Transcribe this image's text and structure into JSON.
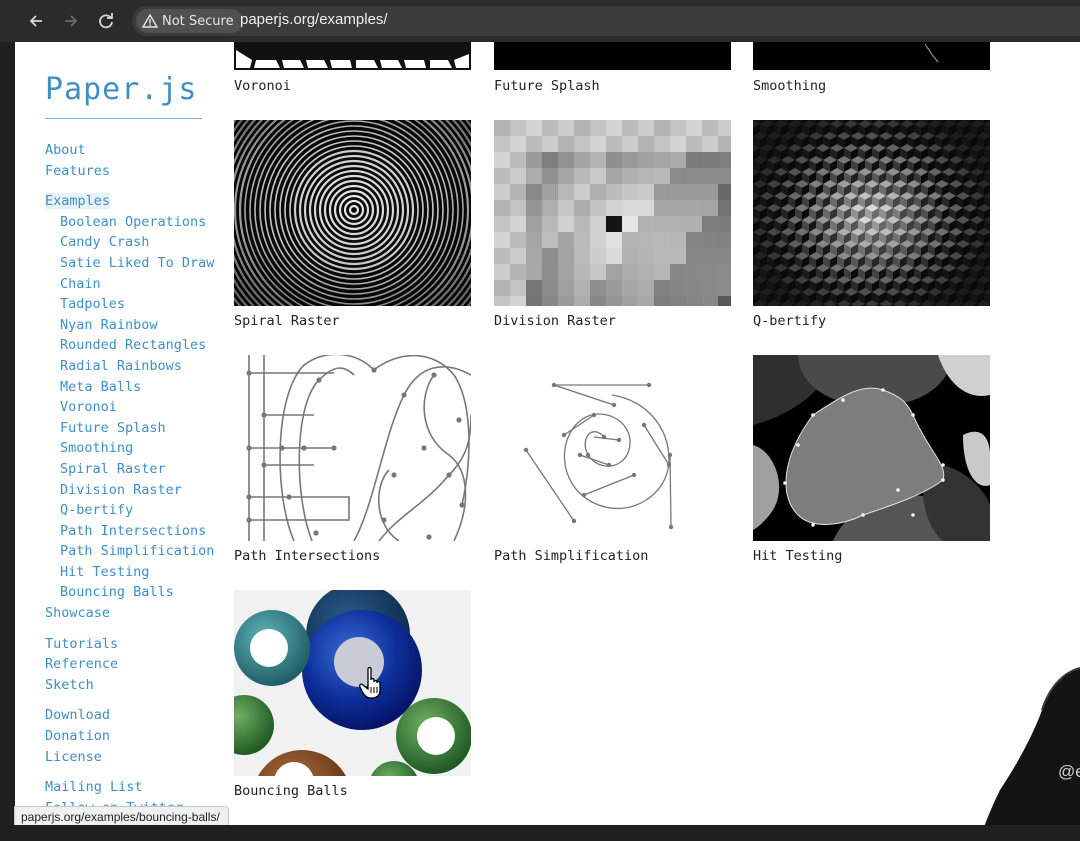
{
  "browser": {
    "back_icon": "arrow-left-icon",
    "forward_icon": "arrow-right-icon",
    "reload_icon": "reload-icon",
    "security_label": "Not Secure",
    "url": "paperjs.org/examples/"
  },
  "site": {
    "logo": "Paper.js"
  },
  "sidebar": {
    "group1": [
      "About",
      "Features"
    ],
    "examples_label": "Examples",
    "examples": [
      "Boolean Operations",
      "Candy Crash",
      "Satie Liked To Draw",
      "Chain",
      "Tadpoles",
      "Nyan Rainbow",
      "Rounded Rectangles",
      "Radial Rainbows",
      "Meta Balls",
      "Voronoi",
      "Future Splash",
      "Smoothing",
      "Spiral Raster",
      "Division Raster",
      "Q-bertify",
      "Path Intersections",
      "Path Simplification",
      "Hit Testing",
      "Bouncing Balls"
    ],
    "showcase": "Showcase",
    "group3": [
      "Tutorials",
      "Reference",
      "Sketch"
    ],
    "group4": [
      "Download",
      "Donation",
      "License"
    ],
    "group5": [
      "Mailing List",
      "Follow on Twitter"
    ]
  },
  "gallery": {
    "row0": [
      "Voronoi",
      "Future Splash",
      "Smoothing"
    ],
    "row1": [
      "Spiral Raster",
      "Division Raster",
      "Q-bertify"
    ],
    "row2": [
      "Path Intersections",
      "Path Simplification",
      "Hit Testing"
    ],
    "row3": [
      "Bouncing Balls"
    ]
  },
  "status_bar": {
    "link_url": "paperjs.org/examples/bouncing-balls/"
  },
  "overlay": {
    "webcam_badge": "@e"
  },
  "colors": {
    "link": "#3f8fc4",
    "text": "#222222",
    "chrome": "#2b2b2b"
  }
}
